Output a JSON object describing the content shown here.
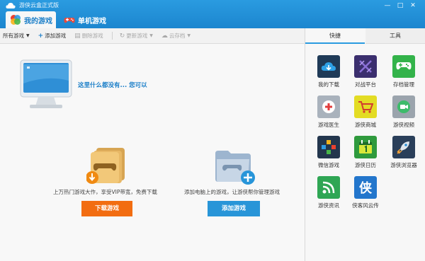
{
  "window": {
    "title": "游侠云盒正式版",
    "minimize": "—",
    "maximize": "□",
    "close": "✕"
  },
  "tabs": [
    {
      "label": "我的游戏",
      "icon": "game-colorful-icon"
    },
    {
      "label": "单机游戏",
      "icon": "gamepad-icon"
    }
  ],
  "toolbar": {
    "all_games": "所有游戏",
    "add_game": "添加游戏",
    "delete_game": "删除游戏",
    "update_game": "更新游戏",
    "cloud_save": "云存档"
  },
  "main": {
    "empty_message": "这里什么都没有... 您可以",
    "promo_download": {
      "description": "上万热门游戏大作，享受VIP带宽，免费下载",
      "button": "下载游戏"
    },
    "promo_add": {
      "description": "添加电脑上的游戏，让游侠帮你管理游戏",
      "button": "添加游戏"
    }
  },
  "panel": {
    "tab_quick": "快捷",
    "tab_tools": "工具",
    "tiles": [
      {
        "label": "我的下载",
        "icon": "cloud-download-icon",
        "color": "#1f3a57"
      },
      {
        "label": "对战平台",
        "icon": "crossed-swords-icon",
        "color": "#3b2f6e"
      },
      {
        "label": "存档管理",
        "icon": "gamepad-icon",
        "color": "#33b34a"
      },
      {
        "label": "游戏医生",
        "icon": "medical-cross-icon",
        "color": "#a9b2bc"
      },
      {
        "label": "游侠商城",
        "icon": "shopping-cart-icon",
        "color": "#e3dc24"
      },
      {
        "label": "游侠视频",
        "icon": "video-chat-icon",
        "color": "#9ba4ad"
      },
      {
        "label": "微信游戏",
        "icon": "colorful-diamond-icon",
        "color": "#23364d"
      },
      {
        "label": "游侠日历",
        "icon": "calendar-icon",
        "color": "#2f9a3d"
      },
      {
        "label": "游侠浏览器",
        "icon": "rocket-icon",
        "color": "#2a3f5a"
      },
      {
        "label": "游侠资讯",
        "icon": "rss-icon",
        "color": "#2fa654"
      },
      {
        "label": "侠客风云传",
        "icon": "xia-character-icon",
        "color": "#2376cc",
        "glyph": "侠"
      }
    ]
  }
}
